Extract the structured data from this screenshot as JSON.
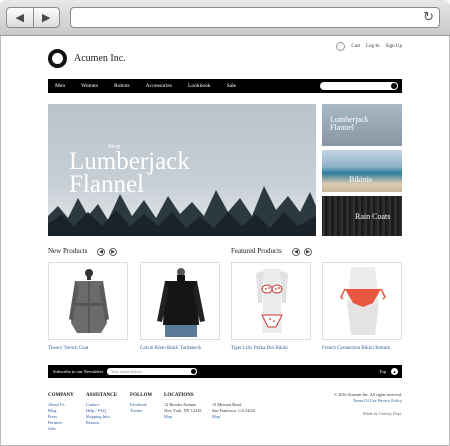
{
  "site": {
    "name": "Acumen Inc."
  },
  "utility": {
    "cart": "Cart",
    "login": "Log In",
    "signup": "Sign Up"
  },
  "nav": {
    "items": [
      "Men",
      "Women",
      "Robots",
      "Accessories",
      "Lookbook",
      "Sale"
    ]
  },
  "hero": {
    "kicker": "Shop",
    "title_line1": "Lumberjack",
    "title_line2": "Flannel"
  },
  "side_banners": [
    {
      "line1": "Lumberjack",
      "line2": "Flannel"
    },
    {
      "line1": "Bikinis",
      "line2": ""
    },
    {
      "line1": "Rain Coats",
      "line2": ""
    }
  ],
  "sections": {
    "new_products": "New Products",
    "featured_products": "Featured Products"
  },
  "products": [
    "Theory Trench Coat",
    "Calvin Klein Black Turtleneck",
    "Tiger Lilly Polka Dot Bikini",
    "French Connection Bikini Bottom"
  ],
  "newsletter": {
    "label": "Subscribe to our Newsletter",
    "placeholder": "Your email address",
    "top": "Top"
  },
  "footer": {
    "company": {
      "heading": "COMPANY",
      "links": [
        "About Us",
        "Blog",
        "Press",
        "Partners",
        "Jobs"
      ]
    },
    "assistance": {
      "heading": "ASSISTANCE",
      "links": [
        "Contact",
        "Help / FAQ",
        "Shipping Info",
        "Returns"
      ]
    },
    "follow": {
      "heading": "FOLLOW",
      "links": [
        "Facebook",
        "Twitter"
      ]
    },
    "locations": {
      "heading": "LOCATIONS",
      "ny": {
        "line1": "12 Brooke Avenue",
        "line2": "New York, NY 12345",
        "map": "Map"
      },
      "sf": {
        "line1": "13 Mission Road",
        "line2": "San Francisco, CA 54321",
        "map": "Map"
      }
    },
    "copyright": "© 2016 Acumen Inc. All rights reserved.",
    "terms": "Terms Of Use",
    "privacy": "Privacy Policy",
    "made_by": "Made by Gravity Dept."
  },
  "colors": {
    "nav_bg": "#000000",
    "link": "#2a5d9e"
  }
}
